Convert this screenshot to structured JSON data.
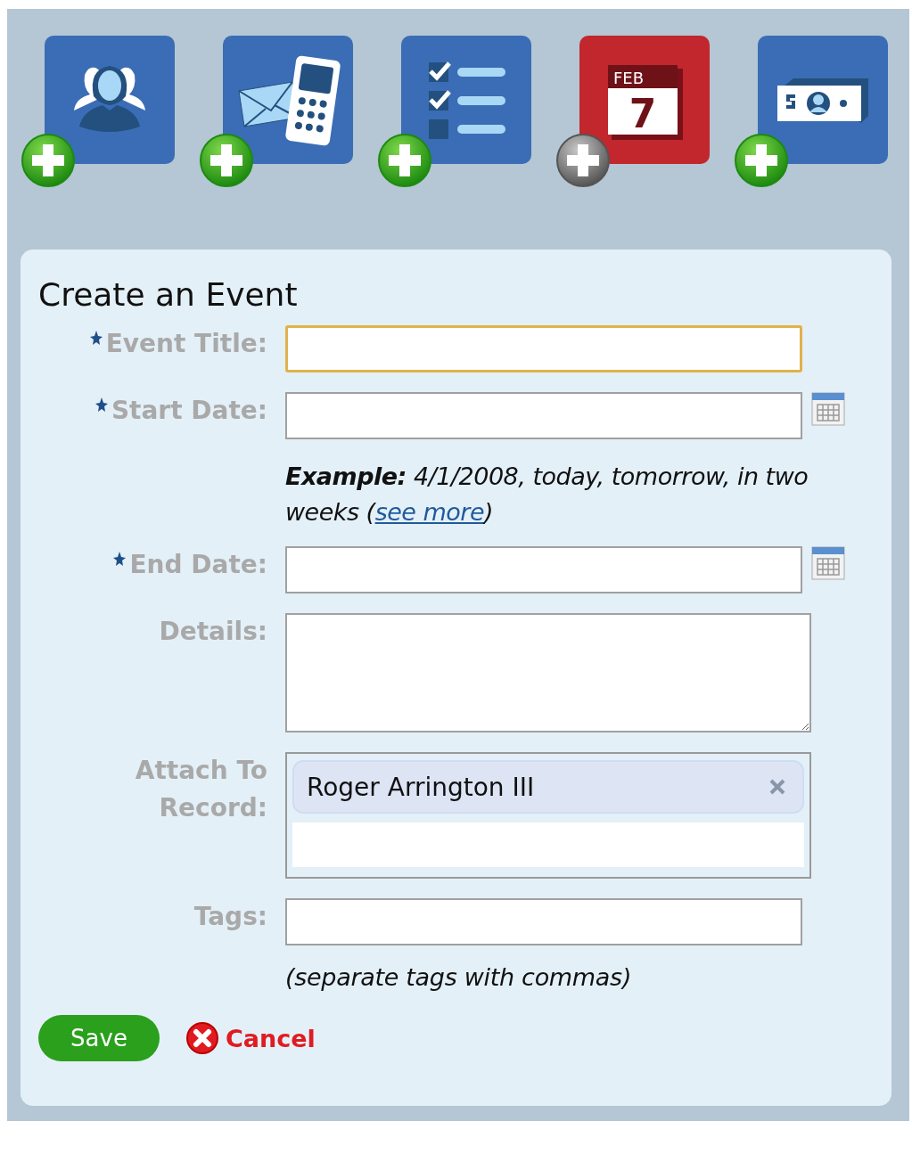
{
  "quick_add": [
    {
      "kind": "people",
      "selected": false
    },
    {
      "kind": "contact",
      "selected": false
    },
    {
      "kind": "tasks",
      "selected": false
    },
    {
      "kind": "calendar",
      "selected": true,
      "month": "FEB",
      "day": "7"
    },
    {
      "kind": "money",
      "selected": false
    }
  ],
  "form": {
    "title": "Create an Event",
    "fields": [
      {
        "label": "Event Title:",
        "kind": "text",
        "required": true,
        "focused": true
      },
      {
        "label": "Start Date:",
        "kind": "date",
        "required": true,
        "focused": false,
        "hint": {
          "text": "**Example:** 4/1/2008, today, tomorrow, in two weeks (",
          "link": "see more",
          "after": ")"
        }
      },
      {
        "label": "End Date:",
        "kind": "date",
        "required": true,
        "focused": false
      },
      {
        "label": "Details:",
        "kind": "textarea",
        "required": false,
        "focused": false
      },
      {
        "label": "Attach To Record:",
        "kind": "record",
        "required": false,
        "focused": false,
        "records": [
          {
            "name": "Roger Arrington III"
          }
        ]
      },
      {
        "label": "Tags:",
        "kind": "text",
        "required": false,
        "focused": false,
        "note": "(separate tags with commas)"
      }
    ],
    "save": "Save",
    "cancel": "Cancel"
  }
}
